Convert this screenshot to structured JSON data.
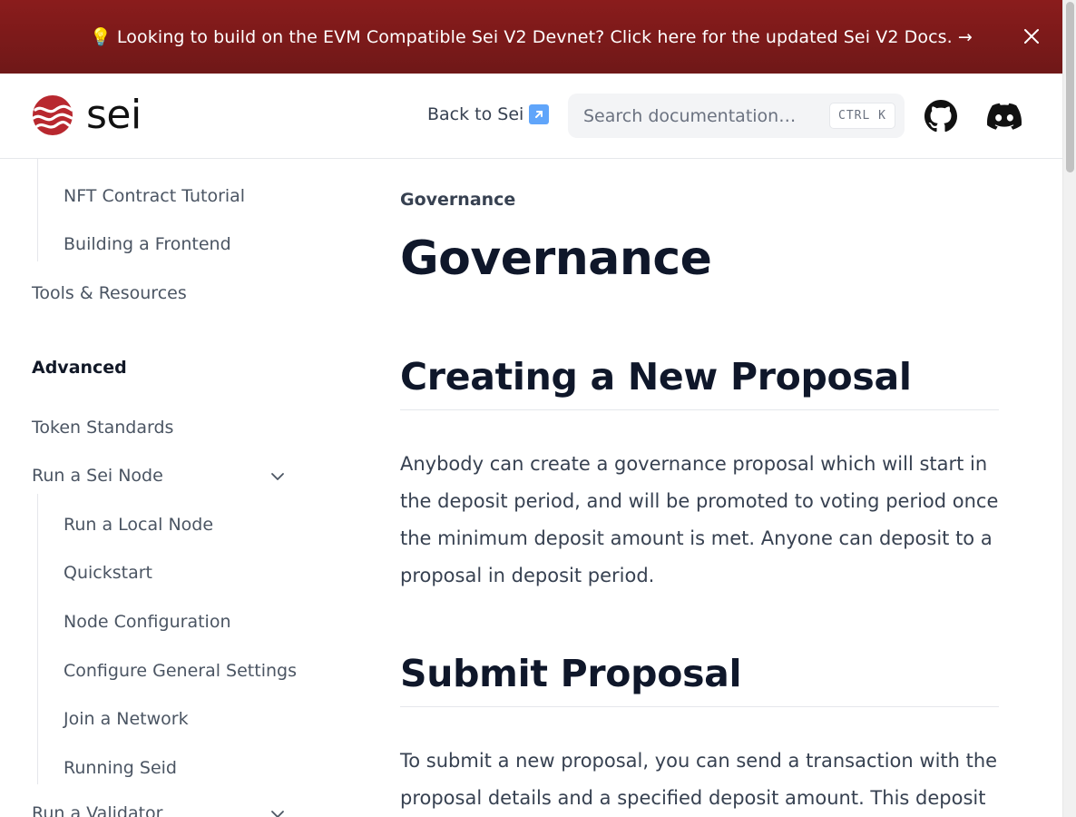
{
  "banner": {
    "text": "💡 Looking to build on the EVM Compatible Sei V2 Devnet? Click here for the updated Sei V2 Docs. →",
    "close_icon": "close-icon",
    "colors": {
      "bg": "#7a1a1a",
      "text": "#ffffff"
    }
  },
  "header": {
    "logo_text": "sei",
    "back_link": "Back to Sei",
    "back_link_icon": "↗",
    "search": {
      "placeholder": "Search documentation…",
      "shortcut": "CTRL K"
    },
    "icons": [
      "github-icon",
      "discord-icon"
    ]
  },
  "sidebar": {
    "items_top": [
      {
        "label": "NFT Contract Tutorial"
      },
      {
        "label": "Building a Frontend"
      }
    ],
    "tools": "Tools & Resources",
    "advanced_heading": "Advanced",
    "token_standards": "Token Standards",
    "run_node": "Run a Sei Node",
    "node_children": [
      {
        "label": "Run a Local Node"
      },
      {
        "label": "Quickstart"
      },
      {
        "label": "Node Configuration"
      },
      {
        "label": "Configure General Settings"
      },
      {
        "label": "Join a Network"
      },
      {
        "label": "Running Seid"
      }
    ],
    "run_validator": "Run a Validator"
  },
  "main": {
    "breadcrumb": "Governance",
    "title": "Governance",
    "section1": {
      "heading": "Creating a New Proposal",
      "body": "Anybody can create a governance proposal which will start in the deposit period, and will be promoted to voting period once the minimum deposit amount is met. Anyone can deposit to a proposal in deposit period."
    },
    "section2": {
      "heading": "Submit Proposal",
      "body": "To submit a new proposal, you can send a transaction with the proposal details and a specified deposit amount. This deposit"
    }
  },
  "colors": {
    "accent": "#c0392b",
    "heading": "#0f172a",
    "text": "#374151",
    "muted": "#4b5563"
  }
}
